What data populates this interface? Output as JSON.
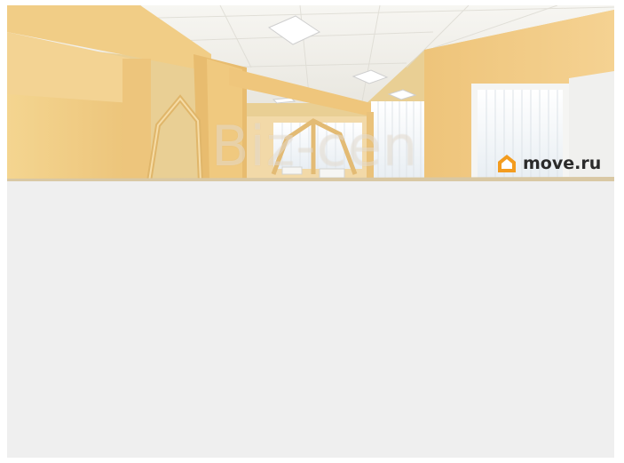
{
  "photo": {
    "subject": "office-interior",
    "watermark_text": "Biz-cen",
    "colors": {
      "wall": "#f2cf8a",
      "wall_shadow": "#e6bd72",
      "ceiling": "#f4f3ef",
      "window": "#f6f8fb",
      "floor": "#d9c8a4"
    }
  },
  "logo": {
    "text": "move.ru",
    "icon": "house-icon",
    "icon_color": "#f39c1f",
    "text_color": "#2b2b2b"
  },
  "background_color": "#efefef"
}
